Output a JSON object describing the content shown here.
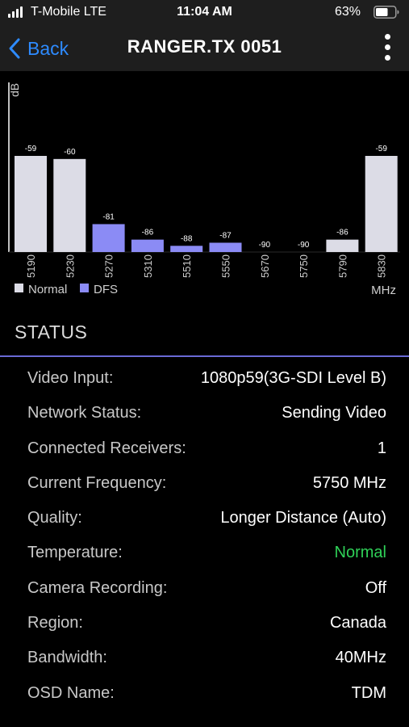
{
  "status_bar": {
    "carrier": "T-Mobile  LTE",
    "time": "11:04 AM",
    "battery": "63%",
    "battery_level": 0.63
  },
  "nav": {
    "back_label": "Back",
    "title": "RANGER.TX 0051"
  },
  "chart_data": {
    "type": "bar",
    "ylabel": "dB",
    "xlabel": "MHz",
    "categories": [
      "5190",
      "5230",
      "5270",
      "5310",
      "5510",
      "5550",
      "5670",
      "5750",
      "5790",
      "5830"
    ],
    "values": [
      -59,
      -60,
      -81,
      -86,
      -88,
      -87,
      -90,
      -90,
      -86,
      -59
    ],
    "value_labels": [
      "-59",
      "-60",
      "-81",
      "-86",
      "-88",
      "-87",
      "-90",
      "-90",
      "-86",
      "-59"
    ],
    "band": [
      "Normal",
      "Normal",
      "DFS",
      "DFS",
      "DFS",
      "DFS",
      "Normal",
      "Normal",
      "Normal",
      "Normal"
    ],
    "ylim": [
      -90,
      -50
    ],
    "legend": [
      {
        "name": "Normal",
        "color": "#dcdce6"
      },
      {
        "name": "DFS",
        "color": "#8b8bf5"
      }
    ],
    "legend_placement": "bottom-left",
    "grid": false
  },
  "status": {
    "title": "STATUS",
    "rows": [
      {
        "label": "Video Input:",
        "value": "1080p59(3G-SDI Level B)"
      },
      {
        "label": "Network Status:",
        "value": "Sending Video"
      },
      {
        "label": "Connected Receivers:",
        "value": "1"
      },
      {
        "label": "Current Frequency:",
        "value": "5750 MHz"
      },
      {
        "label": "Quality:",
        "value": "Longer Distance (Auto)"
      },
      {
        "label": "Temperature:",
        "value": "Normal",
        "value_color": "#2fd158"
      },
      {
        "label": "Camera Recording:",
        "value": "Off"
      },
      {
        "label": "Region:",
        "value": "Canada"
      },
      {
        "label": "Bandwidth:",
        "value": "40MHz"
      },
      {
        "label": "OSD Name:",
        "value": "TDM"
      }
    ]
  }
}
